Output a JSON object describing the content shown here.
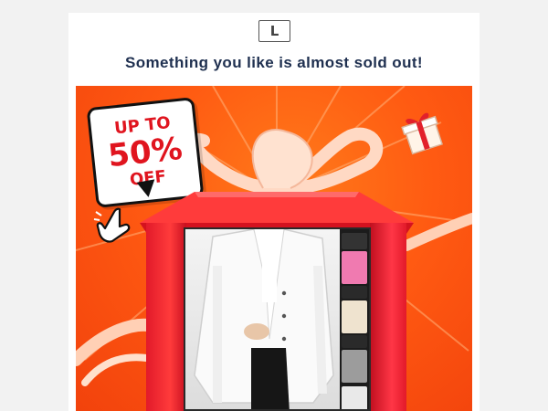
{
  "header": {
    "logo_letter": "L",
    "headline": "Something you like is almost sold out!"
  },
  "banner": {
    "sticker_line1": "UP TO",
    "sticker_line2": "50%",
    "sticker_line3": "OFF",
    "colors": {
      "background": "#ff5a12",
      "frame": "#e21a2a",
      "sticker_text": "#e0151f",
      "ribbon": "#ffd9c4"
    },
    "icons": [
      "pointing-hand-icon",
      "gift-box-icon"
    ]
  }
}
